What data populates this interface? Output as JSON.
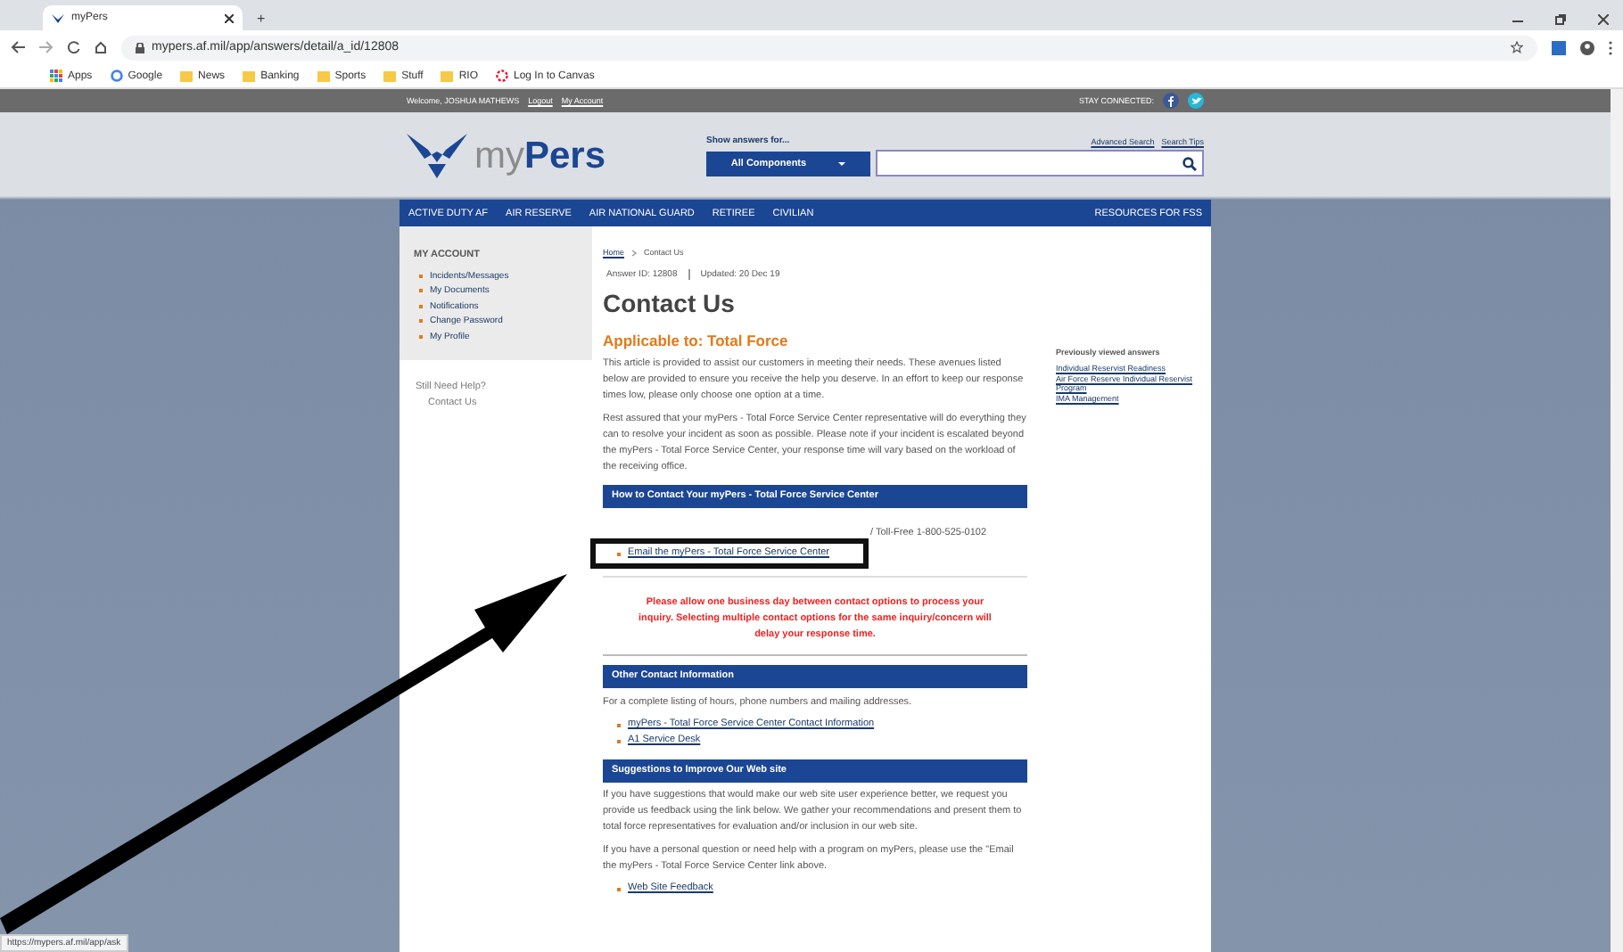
{
  "browser": {
    "tab_title": "myPers",
    "new_tab": "+",
    "url": "mypers.af.mil/app/answers/detail/a_id/12808",
    "bookmarks": [
      {
        "label": "Apps",
        "kind": "apps"
      },
      {
        "label": "Google",
        "kind": "google"
      },
      {
        "label": "News",
        "kind": "folder"
      },
      {
        "label": "Banking",
        "kind": "folder"
      },
      {
        "label": "Sports",
        "kind": "folder"
      },
      {
        "label": "Stuff",
        "kind": "folder"
      },
      {
        "label": "RIO",
        "kind": "folder"
      },
      {
        "label": "Log In to Canvas",
        "kind": "canvas"
      }
    ],
    "status_url": "https://mypers.af.mil/app/ask"
  },
  "topbar": {
    "welcome": "Welcome, JOSHUA MATHEWS",
    "logout": "Logout",
    "my_account": "My Account",
    "stay_connected": "STAY CONNECTED:"
  },
  "header": {
    "logo_prefix": "my",
    "logo_main": "Pers",
    "show_answers": "Show answers for...",
    "component_select": "All Components",
    "advanced_search": "Advanced Search",
    "search_tips": "Search Tips"
  },
  "nav": {
    "items": [
      "ACTIVE DUTY AF",
      "AIR RESERVE",
      "AIR NATIONAL GUARD",
      "RETIREE",
      "CIVILIAN"
    ],
    "right": "RESOURCES FOR FSS"
  },
  "sidebar": {
    "heading": "MY ACCOUNT",
    "items": [
      "Incidents/Messages",
      "My Documents",
      "Notifications",
      "Change Password",
      "My Profile"
    ],
    "help": "Still Need Help?",
    "help_link": "Contact Us"
  },
  "article": {
    "breadcrumb": [
      "Home",
      "Contact Us"
    ],
    "answer_id": "Answer ID: 12808",
    "updated": "Updated: 20 Dec 19",
    "title": "Contact Us",
    "applicable": "Applicable to: Total Force",
    "intro": [
      "This article is provided to assist our customers in meeting their needs. These avenues listed below are provided to ensure you receive the help you deserve. In an effort to keep our response times low, please only choose one option at a time.",
      "Rest assured that your myPers - Total Force Service Center representative will do everything they can to resolve your incident as soon as possible. Please note if your incident is escalated beyond the myPers - Total Force Service Center, your response time will vary based on the workload of the receiving office."
    ],
    "contact_heading": "How to Contact Your myPers - Total Force Service Center",
    "phone": "/ Toll-Free 1-800-525-0102",
    "email_link": "Email the myPers - Total Force Service Center",
    "warning": "Please allow one business day between contact options to process your inquiry. Selecting multiple contact options for the same inquiry/concern will delay your response time.",
    "other_heading": "Other Contact Information",
    "other_text": "For a complete listing of hours, phone numbers and mailing addresses.",
    "other_links": [
      "myPers - Total Force Service Center Contact Information",
      "A1 Service Desk"
    ],
    "suggest_heading": "Suggestions to Improve Our Web site",
    "suggest_text": [
      "If you have suggestions that would make our web site user experience better, we request you provide us feedback using the link below. We gather your recommendations and present them to total force representatives for evaluation and/or inclusion in our web site.",
      "If you have a personal question or need help with a program on myPers, please use the \"Email the myPers - Total Force Service Center link above."
    ],
    "feedback_link": "Web Site Feedback"
  },
  "previously_viewed": {
    "heading": "Previously viewed answers",
    "links": [
      "Individual Reservist Readiness",
      "Air Force Reserve Individual Reservist Program",
      "IMA Management"
    ]
  }
}
